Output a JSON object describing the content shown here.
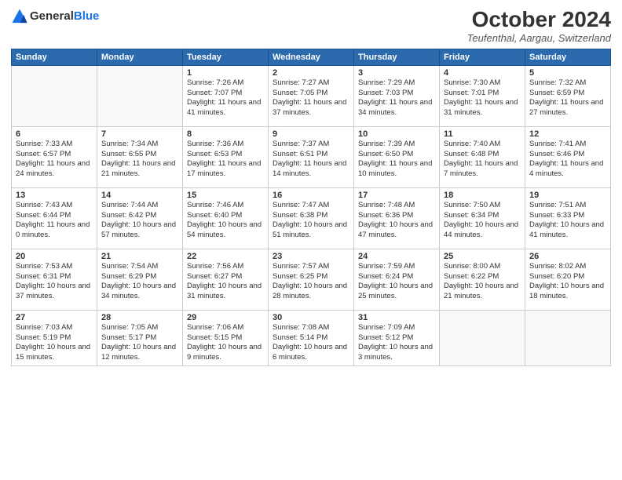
{
  "logo": {
    "general": "General",
    "blue": "Blue"
  },
  "header": {
    "month": "October 2024",
    "location": "Teufenthal, Aargau, Switzerland"
  },
  "weekdays": [
    "Sunday",
    "Monday",
    "Tuesday",
    "Wednesday",
    "Thursday",
    "Friday",
    "Saturday"
  ],
  "weeks": [
    [
      {
        "day": "",
        "info": ""
      },
      {
        "day": "",
        "info": ""
      },
      {
        "day": "1",
        "info": "Sunrise: 7:26 AM\nSunset: 7:07 PM\nDaylight: 11 hours and 41 minutes."
      },
      {
        "day": "2",
        "info": "Sunrise: 7:27 AM\nSunset: 7:05 PM\nDaylight: 11 hours and 37 minutes."
      },
      {
        "day": "3",
        "info": "Sunrise: 7:29 AM\nSunset: 7:03 PM\nDaylight: 11 hours and 34 minutes."
      },
      {
        "day": "4",
        "info": "Sunrise: 7:30 AM\nSunset: 7:01 PM\nDaylight: 11 hours and 31 minutes."
      },
      {
        "day": "5",
        "info": "Sunrise: 7:32 AM\nSunset: 6:59 PM\nDaylight: 11 hours and 27 minutes."
      }
    ],
    [
      {
        "day": "6",
        "info": "Sunrise: 7:33 AM\nSunset: 6:57 PM\nDaylight: 11 hours and 24 minutes."
      },
      {
        "day": "7",
        "info": "Sunrise: 7:34 AM\nSunset: 6:55 PM\nDaylight: 11 hours and 21 minutes."
      },
      {
        "day": "8",
        "info": "Sunrise: 7:36 AM\nSunset: 6:53 PM\nDaylight: 11 hours and 17 minutes."
      },
      {
        "day": "9",
        "info": "Sunrise: 7:37 AM\nSunset: 6:51 PM\nDaylight: 11 hours and 14 minutes."
      },
      {
        "day": "10",
        "info": "Sunrise: 7:39 AM\nSunset: 6:50 PM\nDaylight: 11 hours and 10 minutes."
      },
      {
        "day": "11",
        "info": "Sunrise: 7:40 AM\nSunset: 6:48 PM\nDaylight: 11 hours and 7 minutes."
      },
      {
        "day": "12",
        "info": "Sunrise: 7:41 AM\nSunset: 6:46 PM\nDaylight: 11 hours and 4 minutes."
      }
    ],
    [
      {
        "day": "13",
        "info": "Sunrise: 7:43 AM\nSunset: 6:44 PM\nDaylight: 11 hours and 0 minutes."
      },
      {
        "day": "14",
        "info": "Sunrise: 7:44 AM\nSunset: 6:42 PM\nDaylight: 10 hours and 57 minutes."
      },
      {
        "day": "15",
        "info": "Sunrise: 7:46 AM\nSunset: 6:40 PM\nDaylight: 10 hours and 54 minutes."
      },
      {
        "day": "16",
        "info": "Sunrise: 7:47 AM\nSunset: 6:38 PM\nDaylight: 10 hours and 51 minutes."
      },
      {
        "day": "17",
        "info": "Sunrise: 7:48 AM\nSunset: 6:36 PM\nDaylight: 10 hours and 47 minutes."
      },
      {
        "day": "18",
        "info": "Sunrise: 7:50 AM\nSunset: 6:34 PM\nDaylight: 10 hours and 44 minutes."
      },
      {
        "day": "19",
        "info": "Sunrise: 7:51 AM\nSunset: 6:33 PM\nDaylight: 10 hours and 41 minutes."
      }
    ],
    [
      {
        "day": "20",
        "info": "Sunrise: 7:53 AM\nSunset: 6:31 PM\nDaylight: 10 hours and 37 minutes."
      },
      {
        "day": "21",
        "info": "Sunrise: 7:54 AM\nSunset: 6:29 PM\nDaylight: 10 hours and 34 minutes."
      },
      {
        "day": "22",
        "info": "Sunrise: 7:56 AM\nSunset: 6:27 PM\nDaylight: 10 hours and 31 minutes."
      },
      {
        "day": "23",
        "info": "Sunrise: 7:57 AM\nSunset: 6:25 PM\nDaylight: 10 hours and 28 minutes."
      },
      {
        "day": "24",
        "info": "Sunrise: 7:59 AM\nSunset: 6:24 PM\nDaylight: 10 hours and 25 minutes."
      },
      {
        "day": "25",
        "info": "Sunrise: 8:00 AM\nSunset: 6:22 PM\nDaylight: 10 hours and 21 minutes."
      },
      {
        "day": "26",
        "info": "Sunrise: 8:02 AM\nSunset: 6:20 PM\nDaylight: 10 hours and 18 minutes."
      }
    ],
    [
      {
        "day": "27",
        "info": "Sunrise: 7:03 AM\nSunset: 5:19 PM\nDaylight: 10 hours and 15 minutes."
      },
      {
        "day": "28",
        "info": "Sunrise: 7:05 AM\nSunset: 5:17 PM\nDaylight: 10 hours and 12 minutes."
      },
      {
        "day": "29",
        "info": "Sunrise: 7:06 AM\nSunset: 5:15 PM\nDaylight: 10 hours and 9 minutes."
      },
      {
        "day": "30",
        "info": "Sunrise: 7:08 AM\nSunset: 5:14 PM\nDaylight: 10 hours and 6 minutes."
      },
      {
        "day": "31",
        "info": "Sunrise: 7:09 AM\nSunset: 5:12 PM\nDaylight: 10 hours and 3 minutes."
      },
      {
        "day": "",
        "info": ""
      },
      {
        "day": "",
        "info": ""
      }
    ]
  ]
}
